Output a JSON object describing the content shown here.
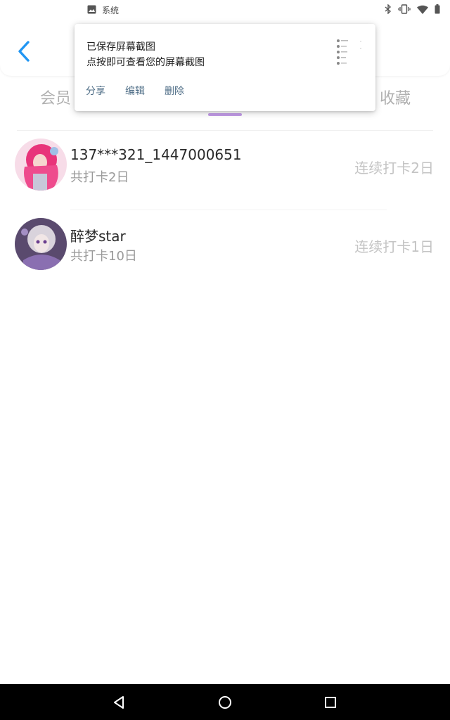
{
  "status_bar": {
    "app_label": "系统",
    "icons": [
      "image-icon",
      "bluetooth-icon",
      "vibrate-icon",
      "wifi-icon",
      "battery-icon"
    ]
  },
  "header": {
    "back_icon": "chevron-left-icon",
    "accent_color": "#2196F3"
  },
  "tabs": {
    "left_label": "会员",
    "right_label": "收藏",
    "indicator_color": "#c29be6"
  },
  "list": {
    "items": [
      {
        "name": "137***321_1447000651",
        "total": "共打卡2日",
        "streak": "连续打卡2日",
        "avatar": "avatar-pink-hair"
      },
      {
        "name": "醉梦star",
        "total": "共打卡10日",
        "streak": "连续打卡1日",
        "avatar": "avatar-purple-hair"
      }
    ]
  },
  "toast": {
    "title": "已保存屏幕截图",
    "subtitle": "点按即可查看您的屏幕截图",
    "actions": [
      "分享",
      "编辑",
      "删除"
    ],
    "action_color": "#4e6d86"
  },
  "nav_bar": {
    "icons": [
      "back-triangle-icon",
      "home-circle-icon",
      "recents-square-icon"
    ]
  }
}
